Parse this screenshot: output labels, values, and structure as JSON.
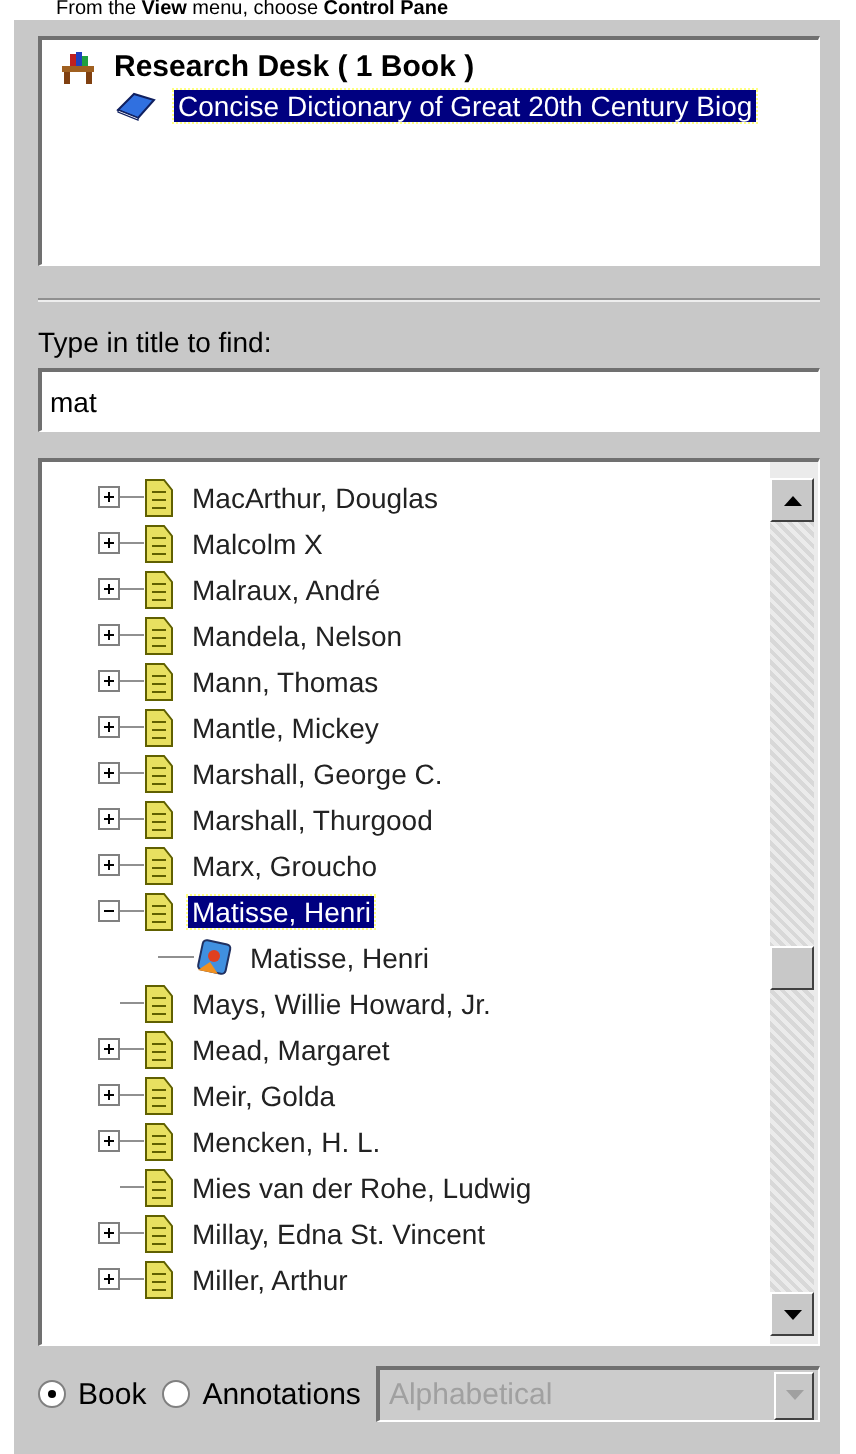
{
  "caption": "From the **View** menu, choose **Control Pane**",
  "desk": {
    "title": "Research Desk ( 1 Book )",
    "books": [
      {
        "title": "Concise Dictionary of Great 20th Century Biog",
        "selected": true
      }
    ]
  },
  "search": {
    "label": "Type in title to find:",
    "value": "mat"
  },
  "tree": [
    {
      "label": "MacArthur, Douglas",
      "expandable": true,
      "expanded": false,
      "selected": false
    },
    {
      "label": "Malcolm X",
      "expandable": true,
      "expanded": false,
      "selected": false
    },
    {
      "label": "Malraux, André",
      "expandable": true,
      "expanded": false,
      "selected": false
    },
    {
      "label": "Mandela, Nelson",
      "expandable": true,
      "expanded": false,
      "selected": false
    },
    {
      "label": "Mann, Thomas",
      "expandable": true,
      "expanded": false,
      "selected": false
    },
    {
      "label": "Mantle, Mickey",
      "expandable": true,
      "expanded": false,
      "selected": false
    },
    {
      "label": "Marshall, George C.",
      "expandable": true,
      "expanded": false,
      "selected": false
    },
    {
      "label": "Marshall, Thurgood",
      "expandable": true,
      "expanded": false,
      "selected": false
    },
    {
      "label": "Marx, Groucho",
      "expandable": true,
      "expanded": false,
      "selected": false
    },
    {
      "label": "Matisse, Henri",
      "expandable": true,
      "expanded": true,
      "selected": true,
      "children": [
        {
          "label": "Matisse, Henri",
          "selected": false
        }
      ]
    },
    {
      "label": "Mays, Willie Howard, Jr.",
      "expandable": false,
      "selected": false
    },
    {
      "label": "Mead, Margaret",
      "expandable": true,
      "expanded": false,
      "selected": false
    },
    {
      "label": "Meir, Golda",
      "expandable": true,
      "expanded": false,
      "selected": false
    },
    {
      "label": "Mencken, H. L.",
      "expandable": true,
      "expanded": false,
      "selected": false
    },
    {
      "label": "Mies van der Rohe, Ludwig",
      "expandable": false,
      "selected": false
    },
    {
      "label": "Millay, Edna St. Vincent",
      "expandable": true,
      "expanded": false,
      "selected": false
    },
    {
      "label": "Miller, Arthur",
      "expandable": true,
      "expanded": false,
      "selected": false
    }
  ],
  "view": [
    {
      "label": "Book",
      "selected": true
    },
    {
      "label": "Annotations",
      "selected": false
    }
  ],
  "sort": {
    "value": "Alphabetical",
    "disabled": true
  }
}
